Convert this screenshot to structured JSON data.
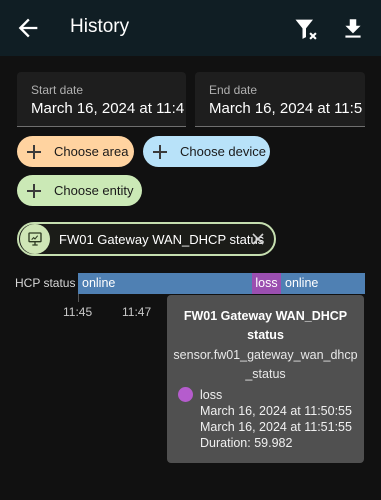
{
  "appbar": {
    "title": "History",
    "icons": [
      "back-arrow-icon",
      "filter-remove-icon",
      "download-icon"
    ]
  },
  "dates": {
    "start_label": "Start date",
    "start_value": "March 16, 2024 at 11:4",
    "end_label": "End date",
    "end_value": "March 16, 2024 at 11:5"
  },
  "target_chips": [
    {
      "label": "Choose area",
      "color": "#ffd3a0"
    },
    {
      "label": "Choose device",
      "color": "#b8e2f9"
    },
    {
      "label": "Choose entity",
      "color": "#cbe9b6"
    }
  ],
  "selected_entity": {
    "label": "FW01 Gateway WAN_DHCP status",
    "icon": "monitor-icon"
  },
  "timeline": {
    "row_label": "HCP status",
    "segments": [
      {
        "state": "online",
        "color": "#4f80b3"
      },
      {
        "state": "loss",
        "color": "#9b4fb0"
      },
      {
        "state": "online",
        "color": "#4f80b3"
      }
    ],
    "ticks": [
      "11:45",
      "11:47"
    ]
  },
  "tooltip": {
    "title_line1": "FW01 Gateway WAN_DHCP",
    "title_line2": "status",
    "entity_line1": "sensor.fw01_gateway_wan_dhcp",
    "entity_line2": "_status",
    "state": "loss",
    "start": "March 16, 2024 at 11:50:55",
    "end": "March 16, 2024 at 11:51:55",
    "duration": "Duration: 59.982"
  }
}
